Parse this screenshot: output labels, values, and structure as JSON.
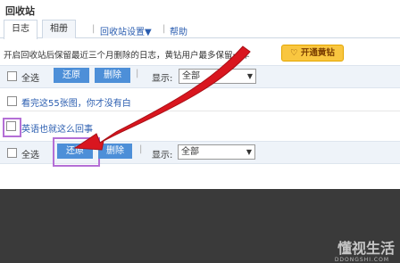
{
  "page": {
    "title": "回收站"
  },
  "tabs": [
    {
      "label": "日志"
    },
    {
      "label": "相册"
    }
  ],
  "settings_link": "回收站设置▼",
  "help_link": "帮助",
  "notice": "开启回收站后保留最近三个月删除的日志，黄钻用户最多保留一年",
  "vip_button": "开通黄钻",
  "toolbar": {
    "select_all": "全选",
    "restore": "还原",
    "delete": "删除",
    "display_label": "显示:",
    "display_value": "全部"
  },
  "entries": [
    {
      "title": "看完这55张图，你才没有白"
    },
    {
      "title": "英语也就这么回事"
    }
  ],
  "watermark": {
    "main": "懂视生活",
    "sub": "DDONGSHI.COM"
  },
  "colors": {
    "accent": "#4d8fd8",
    "arrow": "#d9161f",
    "highlight": "#b46fd6"
  }
}
